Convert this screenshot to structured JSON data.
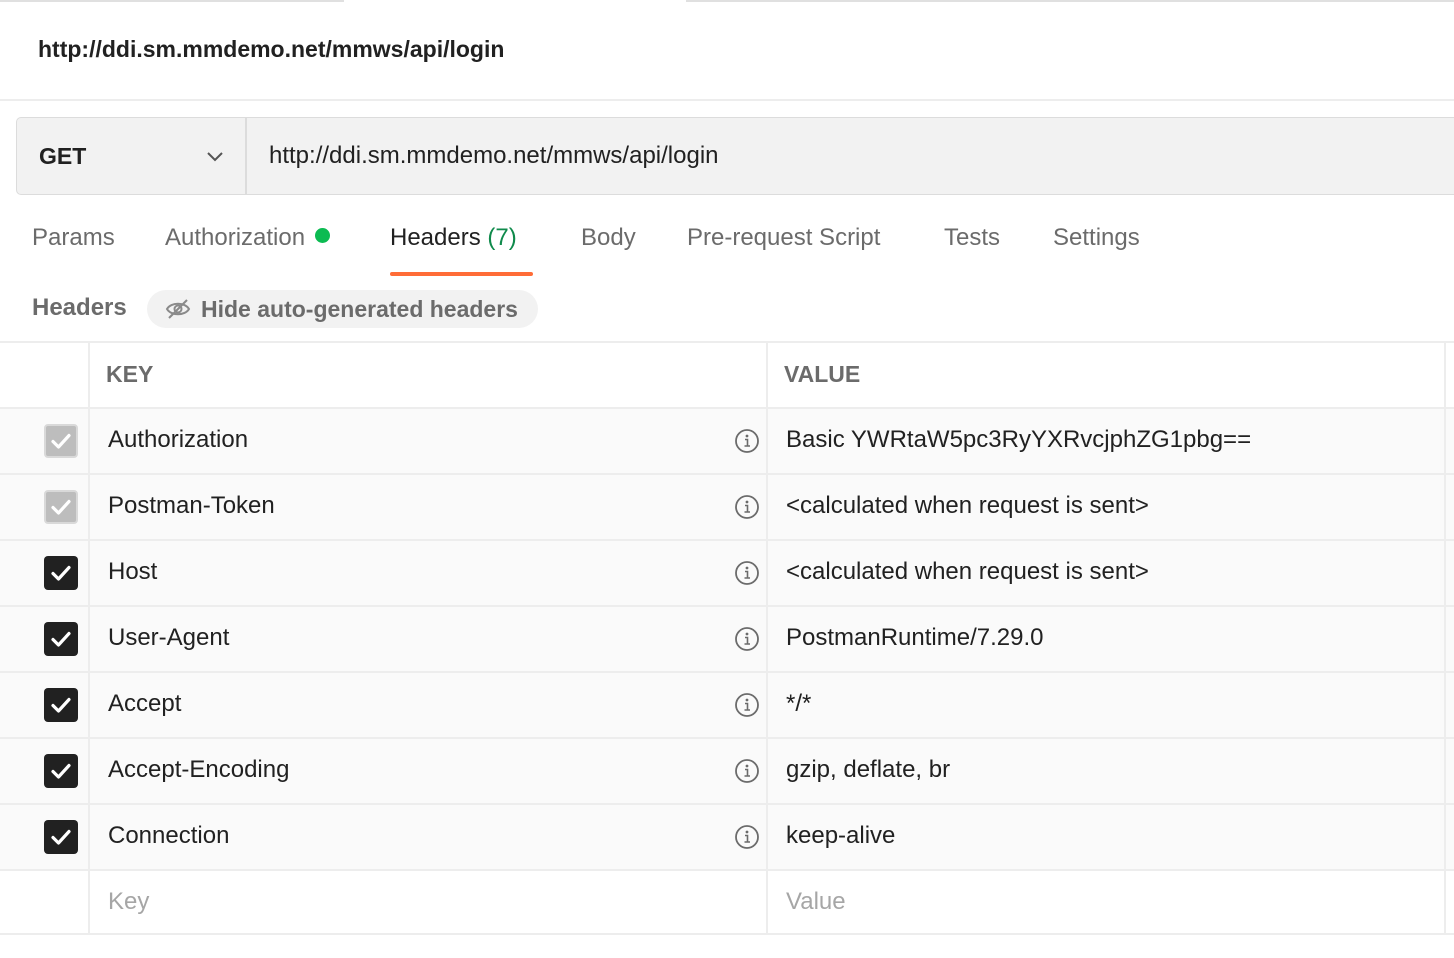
{
  "request": {
    "name": "http://ddi.sm.mmdemo.net/mmws/api/login",
    "method": "GET",
    "url": "http://ddi.sm.mmdemo.net/mmws/api/login"
  },
  "tabs": {
    "params": "Params",
    "authorization": "Authorization",
    "headers": "Headers",
    "headers_count": "(7)",
    "body": "Body",
    "prerequest": "Pre-request Script",
    "tests": "Tests",
    "settings": "Settings"
  },
  "headers_section": {
    "label": "Headers",
    "toggle_label": "Hide auto-generated headers"
  },
  "table": {
    "key_header": "KEY",
    "value_header": "VALUE",
    "rows": [
      {
        "key": "Authorization",
        "value": "Basic YWRtaW5pc3RyYXRvcjphZG1pbg==",
        "checked": true,
        "auto": true
      },
      {
        "key": "Postman-Token",
        "value": "<calculated when request is sent>",
        "checked": true,
        "auto": true
      },
      {
        "key": "Host",
        "value": "<calculated when request is sent>",
        "checked": true,
        "auto": false
      },
      {
        "key": "User-Agent",
        "value": "PostmanRuntime/7.29.0",
        "checked": true,
        "auto": false
      },
      {
        "key": "Accept",
        "value": "*/*",
        "checked": true,
        "auto": false
      },
      {
        "key": "Accept-Encoding",
        "value": "gzip, deflate, br",
        "checked": true,
        "auto": false
      },
      {
        "key": "Connection",
        "value": "keep-alive",
        "checked": true,
        "auto": false
      }
    ],
    "new_key_placeholder": "Key",
    "new_value_placeholder": "Value"
  },
  "colors": {
    "accent": "#ff6c37",
    "auth_dot": "#0cbb52",
    "count": "#0f8a4b"
  },
  "icons": [
    "chevron-down-icon",
    "eye-off-icon",
    "info-icon",
    "checkmark-icon"
  ]
}
